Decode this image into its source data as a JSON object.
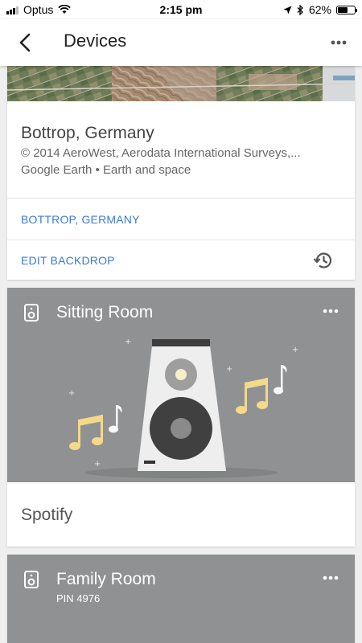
{
  "status_bar": {
    "carrier": "Optus",
    "time": "2:15 pm",
    "battery_text": "62%",
    "battery_level": 0.62
  },
  "app_bar": {
    "title": "Devices",
    "back_icon": "chevron-left-icon",
    "more_icon": "more-horizontal-icon"
  },
  "location_card": {
    "title": "Bottrop, Germany",
    "credit": "© 2014 AeroWest, Aerodata International Surveys,...",
    "source": "Google Earth • Earth and space",
    "location_link": "BOTTROP, GERMANY",
    "edit_backdrop_link": "EDIT BACKDROP",
    "history_icon": "history-icon"
  },
  "devices": [
    {
      "name": "Sitting Room",
      "icon": "speaker-icon",
      "now_playing": "Spotify"
    },
    {
      "name": "Family Room",
      "icon": "speaker-icon",
      "pin": "PIN 4976"
    }
  ],
  "colors": {
    "card_header_gray": "#909192",
    "link_blue": "#3c7bd4",
    "music_note_yellow": "#f3d98a"
  }
}
